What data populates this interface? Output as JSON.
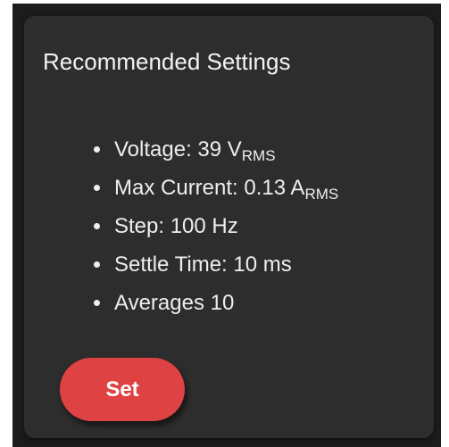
{
  "card": {
    "title": "Recommended Settings",
    "settings": [
      {
        "label": "Voltage: 39 V",
        "unit_sub": "RMS"
      },
      {
        "label": "Max Current: 0.13 A",
        "unit_sub": "RMS"
      },
      {
        "label": "Step: 100 Hz"
      },
      {
        "label": "Settle Time: 10 ms"
      },
      {
        "label": "Averages 10"
      }
    ],
    "set_button_label": "Set"
  },
  "colors": {
    "card_background": "#2d2d2d",
    "frame_background": "#1c1c1c",
    "text": "#eeeeee",
    "accent_button": "#de4243"
  }
}
